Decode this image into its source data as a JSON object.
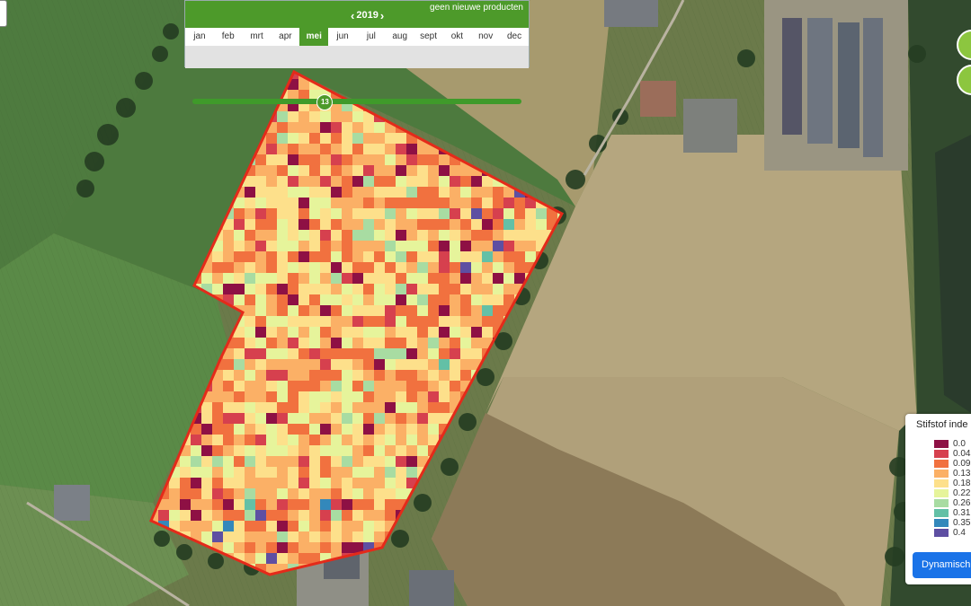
{
  "header": {
    "year": "2019",
    "notice": "geen nieuwe producten",
    "prev_icon": "chevron-left-icon",
    "next_icon": "chevron-right-icon"
  },
  "months": [
    "jan",
    "feb",
    "mrt",
    "apr",
    "mei",
    "jun",
    "jul",
    "aug",
    "sept",
    "okt",
    "nov",
    "dec"
  ],
  "active_month": "mei",
  "slider": {
    "value": "13",
    "position_fraction": 0.4
  },
  "legend": {
    "title": "Stifstof inde",
    "items": [
      {
        "label": "0.0",
        "color": "#8e1044"
      },
      {
        "label": "0.04",
        "color": "#d6404e"
      },
      {
        "label": "0.09",
        "color": "#f1713f"
      },
      {
        "label": "0.13",
        "color": "#fbb066"
      },
      {
        "label": "0.18",
        "color": "#fde08b"
      },
      {
        "label": "0.22",
        "color": "#e6f49b"
      },
      {
        "label": "0.26",
        "color": "#a8dca2"
      },
      {
        "label": "0.31",
        "color": "#63c0a6"
      },
      {
        "label": "0.35",
        "color": "#3388bb"
      },
      {
        "label": "0.4",
        "color": "#5e4fa2"
      }
    ]
  },
  "dynamic_button": "Dynamisch",
  "colors": {
    "accent_green": "#4d9a2a",
    "field_border": "#e42a1a",
    "button_blue": "#1a73e8"
  }
}
